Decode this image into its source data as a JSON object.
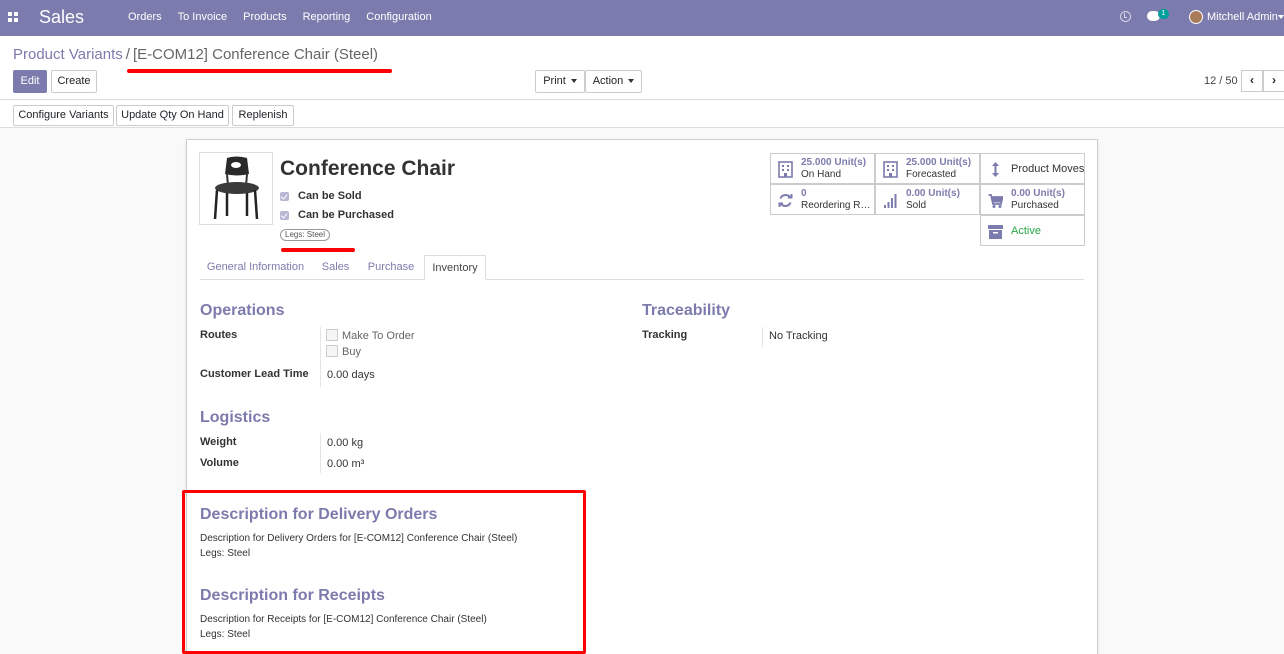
{
  "nav": {
    "app_name": "Sales",
    "menu": [
      "Orders",
      "To Invoice",
      "Products",
      "Reporting",
      "Configuration"
    ],
    "chat_count": "1",
    "user": "Mitchell Admin",
    "color": "#7c7bad"
  },
  "breadcrumb": {
    "parent": "Product Variants",
    "separator": "/",
    "current": "[E-COM12] Conference Chair (Steel)"
  },
  "actions": {
    "edit": "Edit",
    "create": "Create",
    "print": "Print",
    "action": "Action",
    "pager": "12 / 50"
  },
  "header_buttons": {
    "configure": "Configure Variants",
    "update_qty": "Update Qty On Hand",
    "replenish": "Replenish"
  },
  "product": {
    "name": "Conference Chair",
    "can_be_sold": "Can be Sold",
    "can_be_purchased": "Can be Purchased",
    "variant_tag": "Legs: Steel"
  },
  "smart_buttons": {
    "on_hand_value": "25.000 Unit(s)",
    "on_hand_label": "On Hand",
    "forecasted_value": "25.000 Unit(s)",
    "forecasted_label": "Forecasted",
    "product_moves": "Product Moves",
    "reordering_value": "0",
    "reordering_label": "Reordering R…",
    "sold_value": "0.00 Unit(s)",
    "sold_label": "Sold",
    "purchased_value": "0.00 Unit(s)",
    "purchased_label": "Purchased",
    "active": "Active"
  },
  "tabs": [
    "General Information",
    "Sales",
    "Purchase",
    "Inventory"
  ],
  "operations": {
    "title": "Operations",
    "routes_label": "Routes",
    "route_mto": "Make To Order",
    "route_buy": "Buy",
    "lead_time_label": "Customer Lead Time",
    "lead_time_value": "0.00",
    "lead_time_unit": "days"
  },
  "traceability": {
    "title": "Traceability",
    "tracking_label": "Tracking",
    "tracking_value": "No Tracking"
  },
  "logistics": {
    "title": "Logistics",
    "weight_label": "Weight",
    "weight_value": "0.00",
    "weight_unit": "kg",
    "volume_label": "Volume",
    "volume_value": "0.00",
    "volume_unit": "m³"
  },
  "descriptions": {
    "delivery_title": "Description for Delivery Orders",
    "delivery_line1": "Description for Delivery Orders for [E-COM12] Conference Chair (Steel)",
    "delivery_line2": "Legs: Steel",
    "receipts_title": "Description for Receipts",
    "receipts_line1": "Description for Receipts for [E-COM12] Conference Chair (Steel)",
    "receipts_line2": "Legs: Steel"
  }
}
